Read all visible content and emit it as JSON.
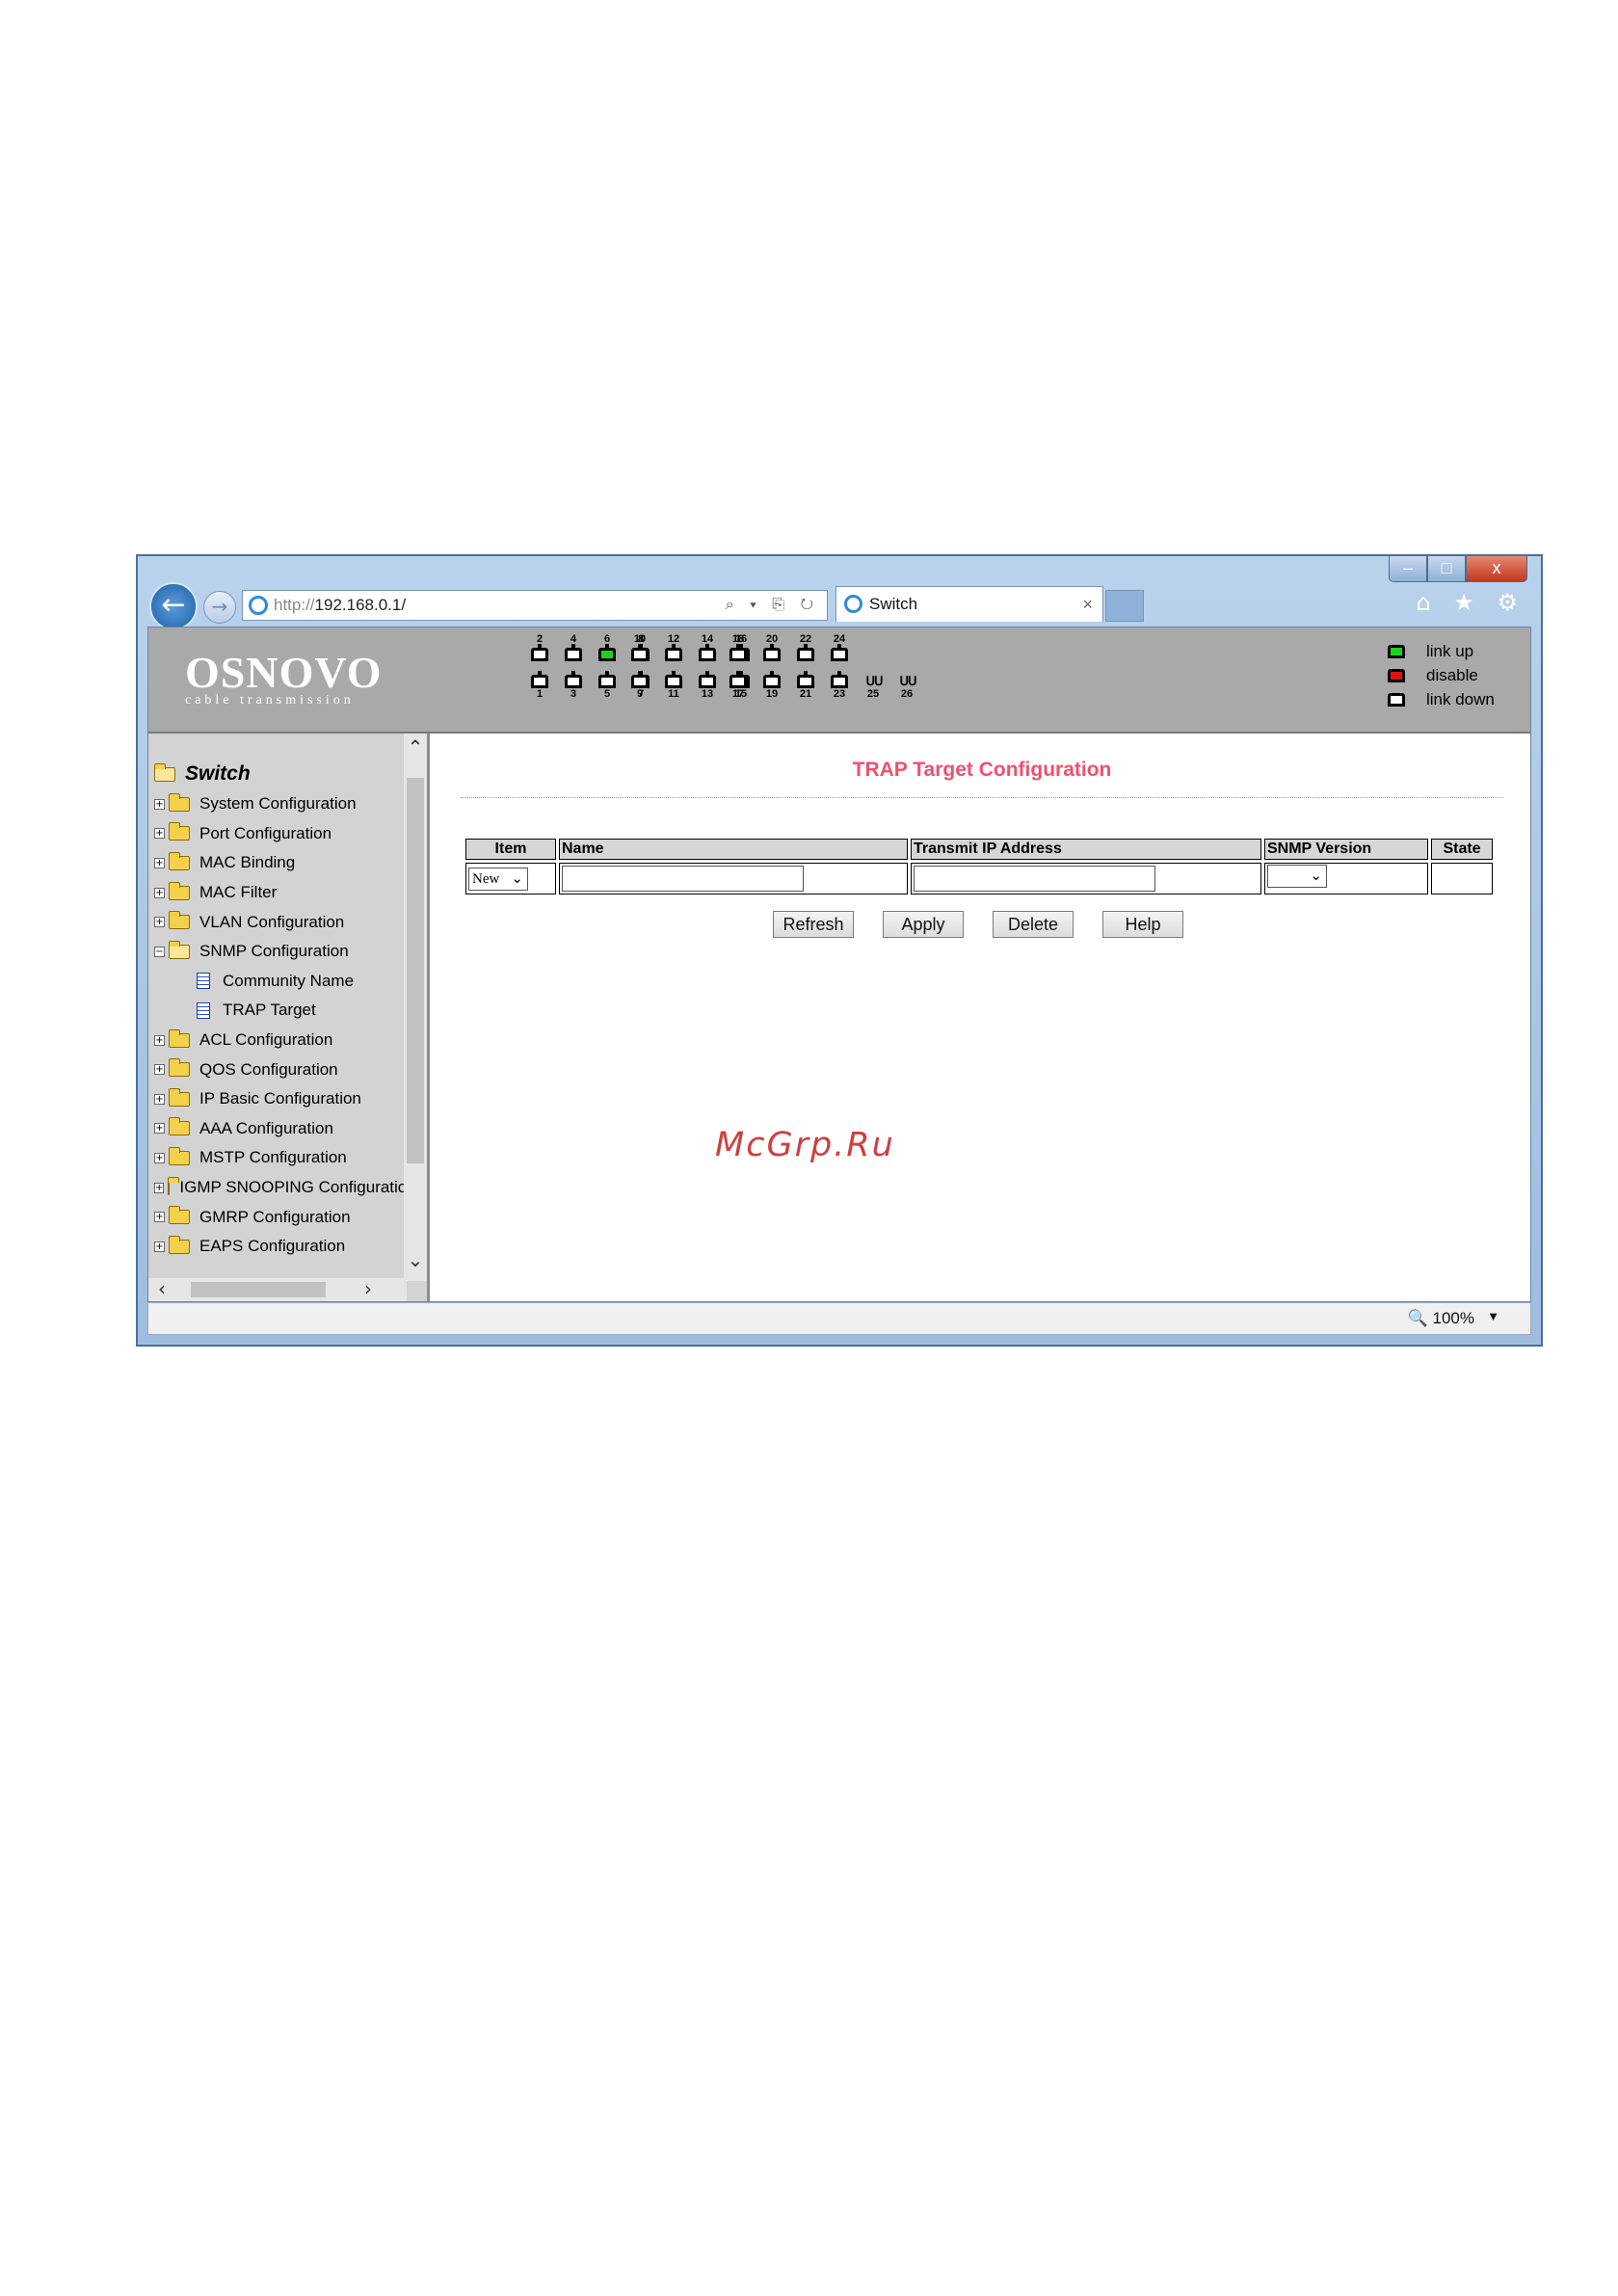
{
  "browser": {
    "address_protocol": "http://",
    "address_host": "192.168.0.1/",
    "address_tools": "⌕ ▾ ⎘ ↻",
    "tab_title": "Switch",
    "tab_close": "×",
    "title_buttons": {
      "min": "–",
      "max": "□",
      "close": "x"
    },
    "right_icons": "⌂ ★ ⚙",
    "zoom": "🔍 100%"
  },
  "header": {
    "brand": "OSNOVO",
    "tagline": "cable transmission",
    "ports_top": [
      {
        "n": "2",
        "state": "down"
      },
      {
        "n": "4",
        "state": "down"
      },
      {
        "n": "6",
        "state": "up"
      },
      {
        "n": "8",
        "state": "down"
      },
      {
        "n": "10",
        "state": "down"
      },
      {
        "n": "12",
        "state": "down"
      },
      {
        "n": "14",
        "state": "down"
      },
      {
        "n": "16",
        "state": "down"
      },
      {
        "n": "18",
        "state": "down"
      },
      {
        "n": "20",
        "state": "down"
      },
      {
        "n": "22",
        "state": "down"
      },
      {
        "n": "24",
        "state": "down"
      }
    ],
    "ports_bottom": [
      {
        "n": "1",
        "state": "down"
      },
      {
        "n": "3",
        "state": "down"
      },
      {
        "n": "5",
        "state": "down"
      },
      {
        "n": "7",
        "state": "down"
      },
      {
        "n": "9",
        "state": "down"
      },
      {
        "n": "11",
        "state": "down"
      },
      {
        "n": "13",
        "state": "down"
      },
      {
        "n": "15",
        "state": "down"
      },
      {
        "n": "17",
        "state": "down"
      },
      {
        "n": "19",
        "state": "down"
      },
      {
        "n": "21",
        "state": "down"
      },
      {
        "n": "23",
        "state": "down"
      }
    ],
    "ports_sfp": [
      {
        "n": "25"
      },
      {
        "n": "26"
      }
    ],
    "legend": [
      {
        "label": "link up",
        "color": "#1ad41a"
      },
      {
        "label": "disable",
        "color": "#e01010"
      },
      {
        "label": "link down",
        "color": "#ffffff"
      }
    ]
  },
  "sidebar": {
    "root": "Switch",
    "items": [
      {
        "label": "System Configuration",
        "expanded": false
      },
      {
        "label": "Port Configuration",
        "expanded": false
      },
      {
        "label": "MAC Binding",
        "expanded": false
      },
      {
        "label": "MAC Filter",
        "expanded": false
      },
      {
        "label": "VLAN Configuration",
        "expanded": false
      },
      {
        "label": "SNMP Configuration",
        "expanded": true,
        "children": [
          "Community Name",
          "TRAP Target"
        ]
      },
      {
        "label": "ACL Configuration",
        "expanded": false
      },
      {
        "label": "QOS Configuration",
        "expanded": false
      },
      {
        "label": "IP Basic Configuration",
        "expanded": false
      },
      {
        "label": "AAA Configuration",
        "expanded": false
      },
      {
        "label": "MSTP Configuration",
        "expanded": false
      },
      {
        "label": "IGMP SNOOPING Configuration",
        "expanded": false
      },
      {
        "label": "GMRP Configuration",
        "expanded": false
      },
      {
        "label": "EAPS Configuration",
        "expanded": false
      }
    ]
  },
  "main": {
    "title": "TRAP Target Configuration",
    "columns": {
      "item": "Item",
      "name": "Name",
      "ip": "Transmit IP Address",
      "version": "SNMP Version",
      "state": "State"
    },
    "row": {
      "item_value": "New",
      "name_value": "",
      "ip_value": "",
      "version_value": "",
      "state_value": ""
    },
    "buttons": {
      "refresh": "Refresh",
      "apply": "Apply",
      "delete": "Delete",
      "help": "Help"
    }
  },
  "watermark": "McGrp.Ru"
}
